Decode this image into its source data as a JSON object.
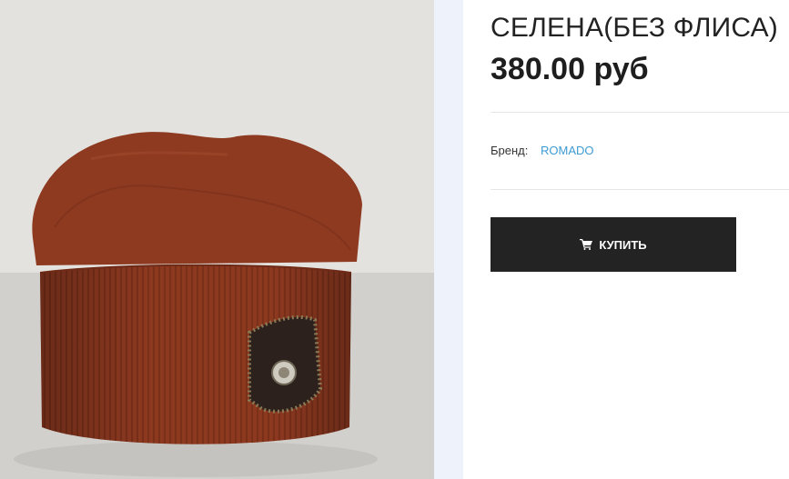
{
  "product": {
    "title": "СЕЛЕНА(БЕЗ ФЛИСА)",
    "price": "380.00 руб",
    "brand_label": "Бренд:",
    "brand_value": "ROMADO",
    "buy_label": "КУПИТЬ",
    "image_subject": "rust-colored knit beanie with leather badge",
    "buy_icon": "cart-icon"
  },
  "colors": {
    "hat": "#8f3a22",
    "brand_link": "#3d9bd4",
    "button_bg": "#232323"
  }
}
